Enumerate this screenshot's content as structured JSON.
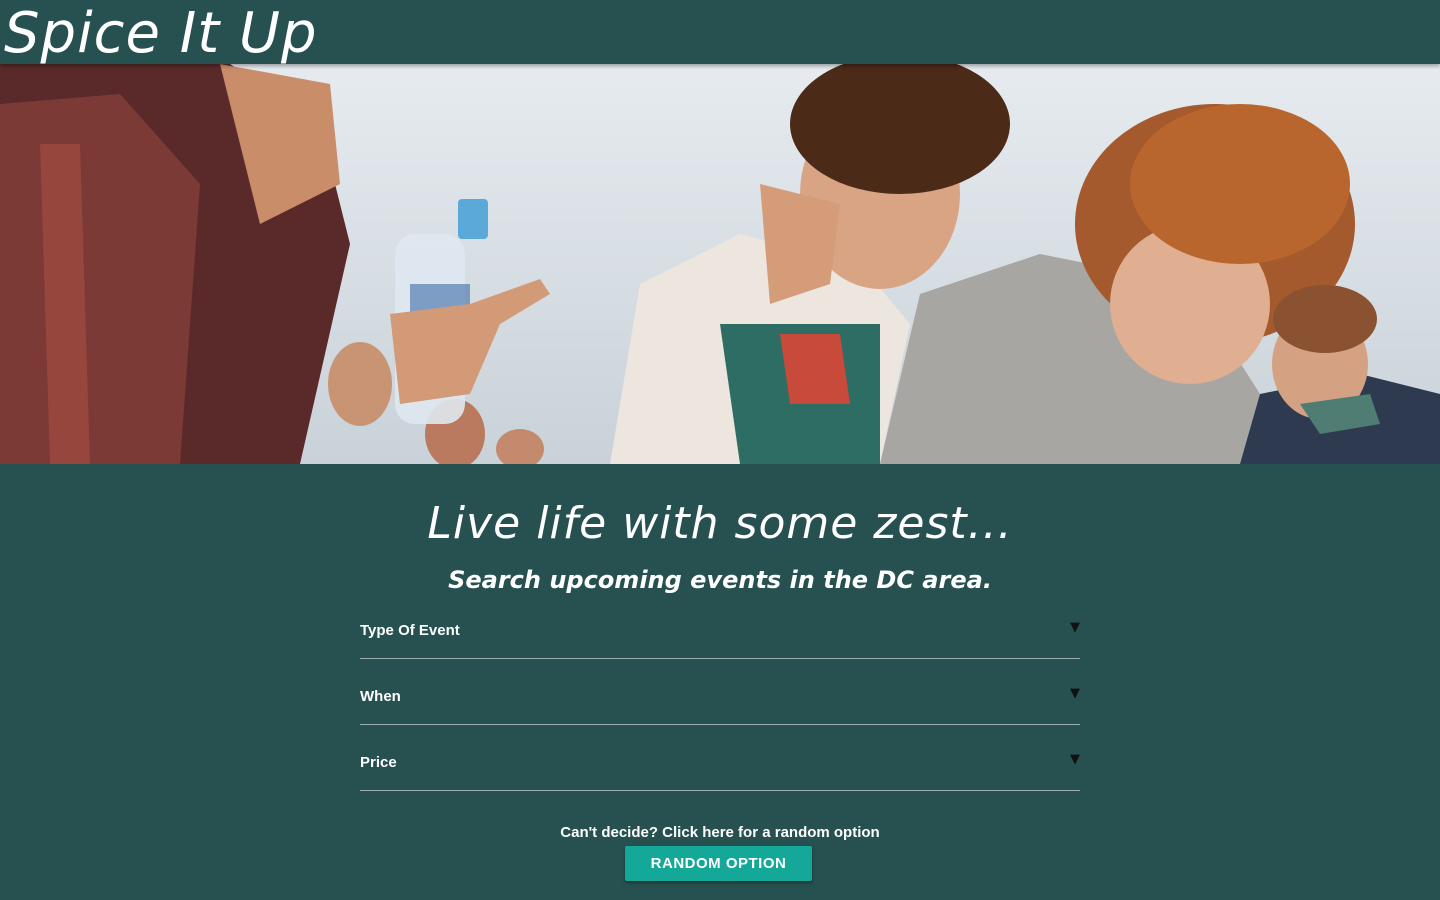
{
  "header": {
    "brand": "Spice It Up"
  },
  "hero": {
    "image_description": "Crowd of young people dancing outdoors at a festival"
  },
  "main": {
    "tagline": "Live life with some zest...",
    "subtagline": "Search upcoming events in the DC area.",
    "filters": [
      {
        "label": "Type Of Event"
      },
      {
        "label": "When"
      },
      {
        "label": "Price"
      }
    ],
    "random_note": "Can't decide? Click here for a random option",
    "random_button_label": "Random Option"
  },
  "colors": {
    "background": "#265150",
    "accent_button": "#14a898",
    "text": "#ffffff"
  }
}
